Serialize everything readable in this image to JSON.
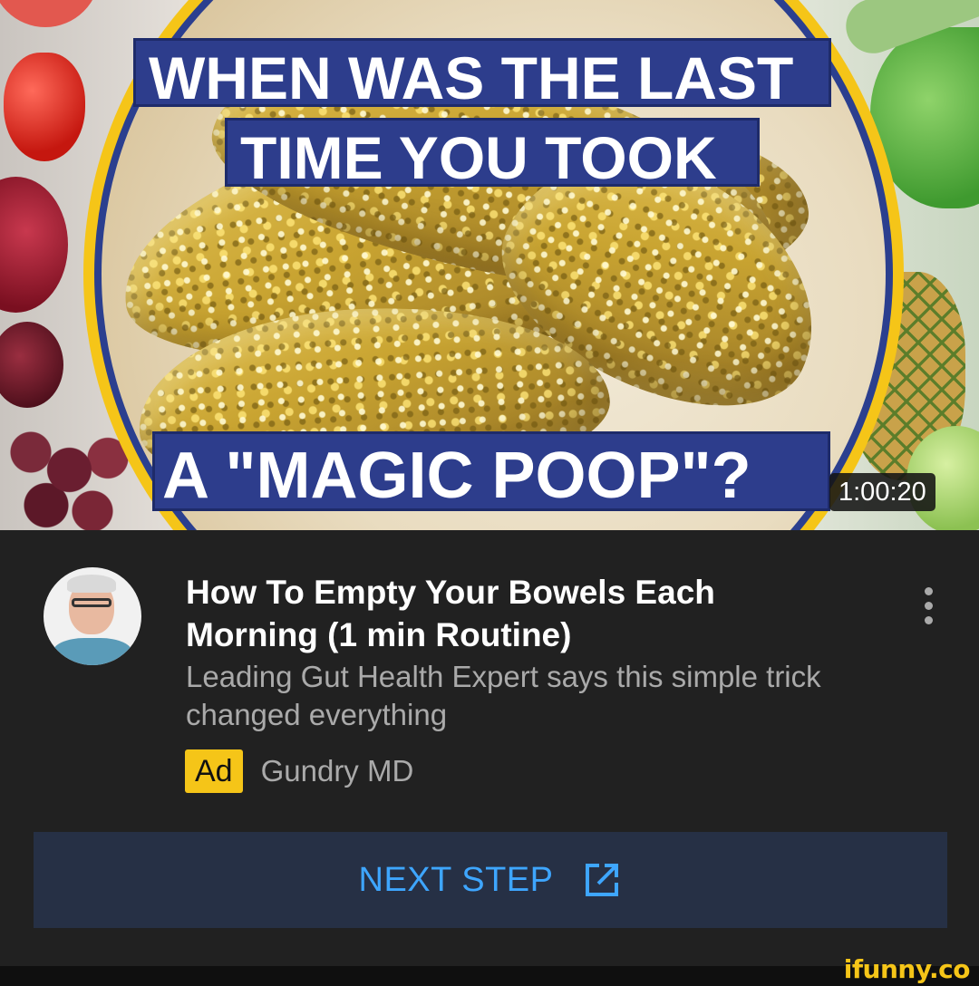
{
  "thumbnail": {
    "headline_line1": "WHEN WAS THE LAST",
    "headline_line2": "TIME YOU TOOK",
    "headline_line3": "A \"MAGIC POOP\"?",
    "duration": "1:00:20",
    "colors": {
      "banner": "#2d3d8c",
      "ring": "#f5c518"
    }
  },
  "video": {
    "title": "How To Empty Your Bowels Each Morning (1 min Routine)",
    "description": "Leading Gut Health Expert says this simple trick changed everything",
    "ad_badge": "Ad",
    "advertiser": "Gundry MD",
    "menu_icon": "more-vert-icon"
  },
  "cta": {
    "label": "NEXT STEP",
    "icon": "external-link-icon",
    "color": "#3ea6ff",
    "background": "#263045"
  },
  "watermark": "ifunny.co"
}
